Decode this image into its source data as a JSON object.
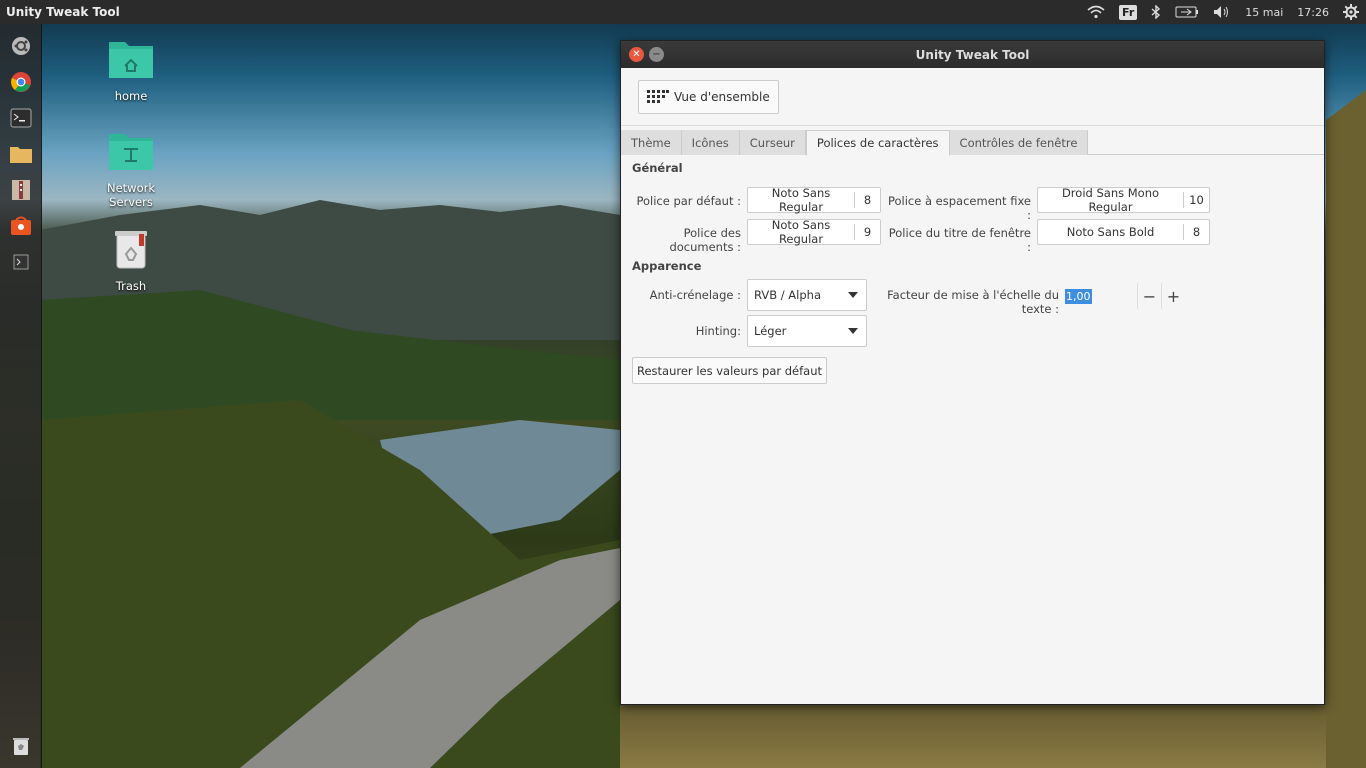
{
  "top_panel": {
    "app_title": "Unity Tweak Tool",
    "keyboard_layout": "Fr",
    "date": "15 mai",
    "time": "17:26",
    "icons": [
      "wifi-icon",
      "bluetooth-icon",
      "battery-icon",
      "volume-icon",
      "settings-gear-icon"
    ]
  },
  "launcher": {
    "items": [
      "dash-icon",
      "chrome-icon",
      "terminal-icon",
      "files-icon",
      "archive-manager-icon",
      "software-center-icon",
      "shell-icon",
      "trash-icon"
    ]
  },
  "desktop": {
    "icons": [
      {
        "label": "home"
      },
      {
        "label": "Network Servers"
      },
      {
        "label": "Trash"
      }
    ]
  },
  "window": {
    "title": "Unity Tweak Tool",
    "overview_label": "Vue d'ensemble",
    "tabs": [
      {
        "label": "Thème",
        "active": false
      },
      {
        "label": "Icônes",
        "active": false
      },
      {
        "label": "Curseur",
        "active": false
      },
      {
        "label": "Polices de caractères",
        "active": true
      },
      {
        "label": "Contrôles de fenêtre",
        "active": false
      }
    ],
    "general": {
      "title": "Général",
      "default_font_label": "Police par défaut :",
      "default_font_name": "Noto Sans Regular",
      "default_font_size": "8",
      "monospace_font_label": "Police à espacement fixe :",
      "monospace_font_name": "Droid Sans Mono Regular",
      "monospace_font_size": "10",
      "document_font_label": "Police des documents :",
      "document_font_name": "Noto Sans Regular",
      "document_font_size": "9",
      "titlebar_font_label": "Police du titre de fenêtre :",
      "titlebar_font_name": "Noto Sans Bold",
      "titlebar_font_size": "8"
    },
    "appearance": {
      "title": "Apparence",
      "antialias_label": "Anti-crénelage :",
      "antialias_value": "RVB / Alpha",
      "scale_label": "Facteur de mise à l'échelle du texte :",
      "scale_value": "1,00",
      "minus": "−",
      "plus": "+",
      "hinting_label": "Hinting:",
      "hinting_value": "Léger"
    },
    "reset_label": "Restaurer les valeurs par défaut"
  },
  "colors": {
    "close_button": "#e9573f",
    "selection": "#3d8ee0",
    "folder_teal": "#3cc8a8"
  }
}
